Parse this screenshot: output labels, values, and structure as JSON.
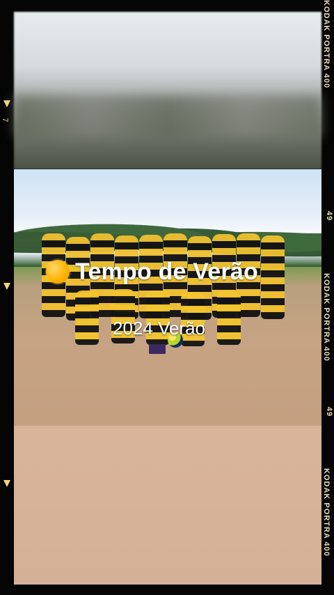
{
  "overlay": {
    "title": "Tempo de Verão",
    "subtitle": "2024 Verão"
  },
  "film_labels": {
    "right_brand_top": "KODAK PORTRA 400",
    "right_number_1": "49",
    "right_brand_mid": "KODAK PORTRA 400",
    "right_number_2": "49",
    "right_brand_bottom": "KODAK PORTRA 400",
    "left_number": "7"
  },
  "icons": {
    "sun": "sun-icon",
    "left_marker": "triangle-marker-icon"
  },
  "colors": {
    "frame": "#050505",
    "film_text": "#eadfb9",
    "marker": "#f1d77a"
  }
}
